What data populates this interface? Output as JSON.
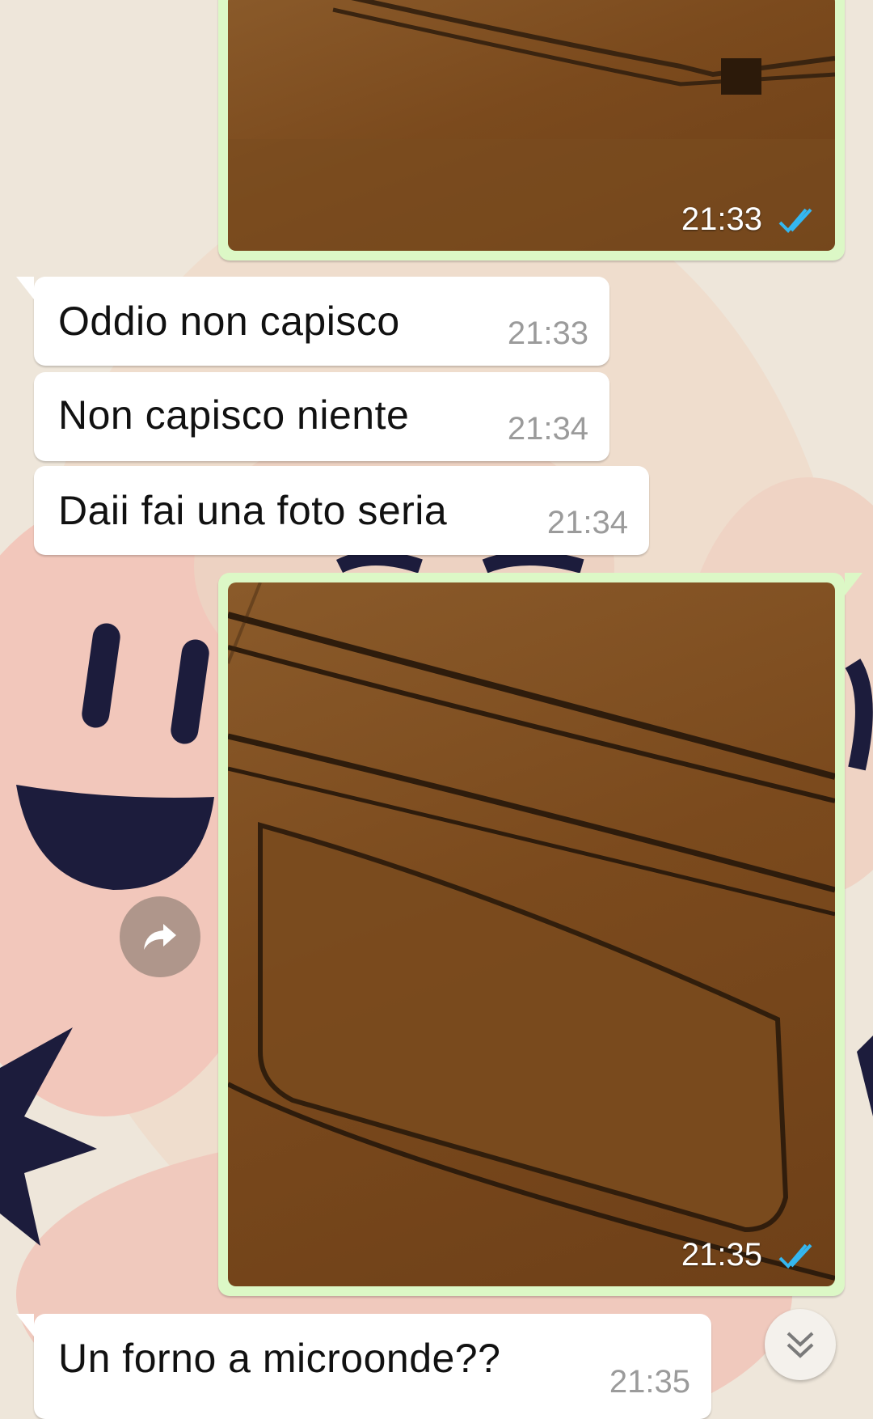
{
  "messages": [
    {
      "type": "image",
      "direction": "outgoing",
      "time": "21:33",
      "status": "read"
    },
    {
      "type": "text",
      "direction": "incoming",
      "text": "Oddio non capisco",
      "time": "21:33"
    },
    {
      "type": "text",
      "direction": "incoming",
      "text": "Non capisco niente",
      "time": "21:34"
    },
    {
      "type": "text",
      "direction": "incoming",
      "text": "Daii fai una foto seria",
      "time": "21:34"
    },
    {
      "type": "image",
      "direction": "outgoing",
      "time": "21:35",
      "status": "read"
    },
    {
      "type": "text",
      "direction": "incoming",
      "text": "Un forno a microonde??",
      "time": "21:35"
    }
  ],
  "icons": {
    "forward": "forward-arrow-icon",
    "scroll_down": "double-chevron-down-icon",
    "read_receipt": "double-check-icon"
  },
  "colors": {
    "outgoing_bubble": "#dcf8c6",
    "incoming_bubble": "#ffffff",
    "read_tick": "#34b7f1",
    "time_gray": "#9b9b9b"
  }
}
